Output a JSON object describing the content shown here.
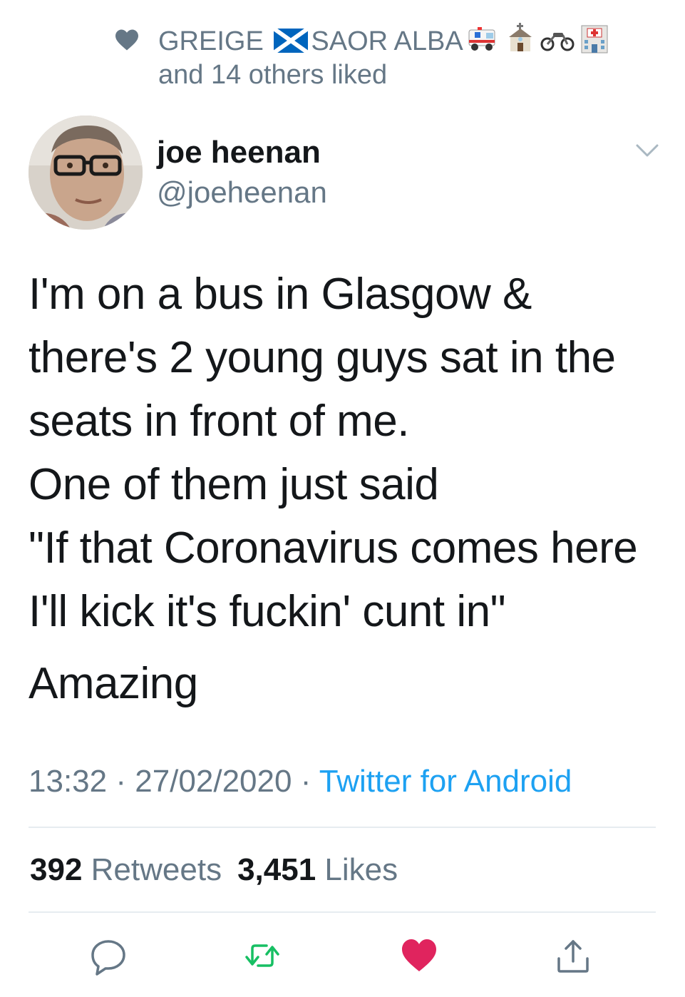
{
  "liked_by": {
    "name_part1": "GREIGE",
    "flag_icon": "scotland-flag-icon",
    "name_part2": "SAOR ALBA",
    "emojis": [
      "ambulance-icon",
      "church-icon",
      "motorcycle-icon",
      "hospital-icon"
    ],
    "others": "and 14 others liked"
  },
  "author": {
    "name": "joe heenan",
    "handle": "@joeheenan"
  },
  "tweet": {
    "lines": [
      "I'm on a bus in Glasgow &",
      "there's 2 young guys sat in the",
      "seats in front of me.",
      "One of them just said",
      "\"If that Coronavirus comes here",
      "I'll kick it's fuckin' cunt in\""
    ],
    "closing": "Amazing"
  },
  "meta": {
    "time": "13:32",
    "separator": "·",
    "date": "27/02/2020",
    "source": "Twitter for Android"
  },
  "stats": {
    "retweets_count": "392",
    "retweets_label": "Retweets",
    "likes_count": "3,451",
    "likes_label": "Likes"
  },
  "colors": {
    "link": "#1da1f2",
    "secondary": "#657786",
    "retweet_green": "#17bf63",
    "like_red": "#e0245e"
  }
}
